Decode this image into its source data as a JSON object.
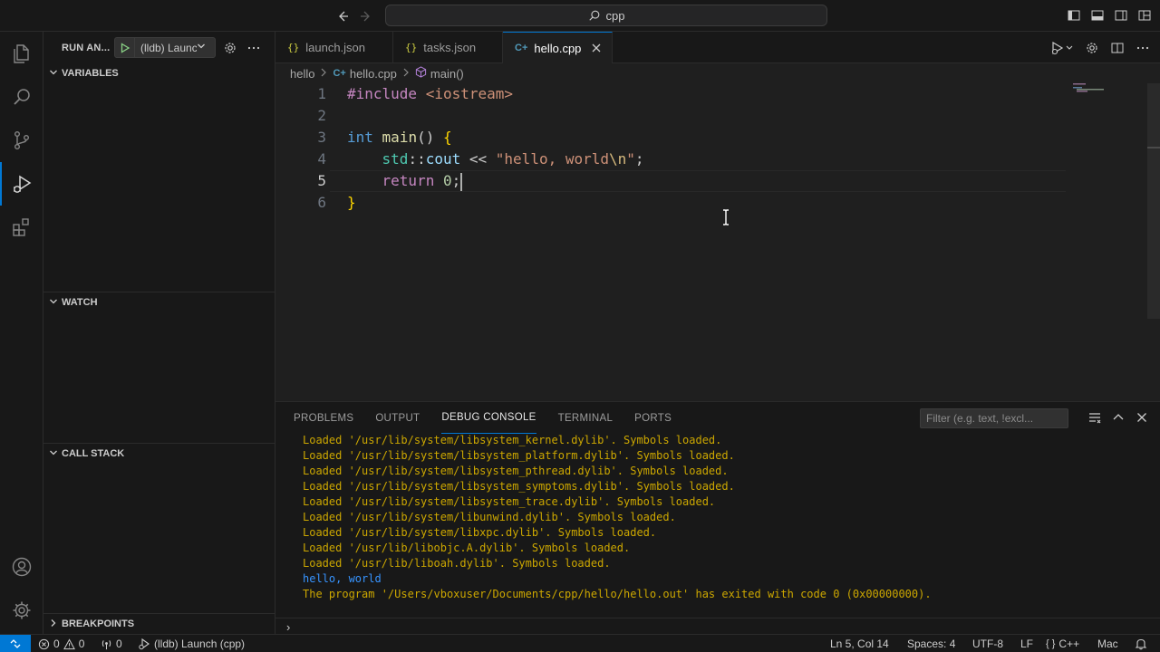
{
  "titlebar": {
    "search_text": "cpp"
  },
  "sidebar": {
    "title": "RUN AN...",
    "launch_config": "(lldb) Launch",
    "sections": {
      "variables": "VARIABLES",
      "watch": "WATCH",
      "call_stack": "CALL STACK",
      "breakpoints": "BREAKPOINTS"
    }
  },
  "tabs": [
    {
      "label": "launch.json",
      "icon": "json-icon"
    },
    {
      "label": "tasks.json",
      "icon": "json-icon"
    },
    {
      "label": "hello.cpp",
      "icon": "cpp-icon",
      "active": true
    }
  ],
  "breadcrumb": {
    "folder": "hello",
    "file": "hello.cpp",
    "symbol": "main()"
  },
  "editor": {
    "line_numbers": [
      "1",
      "2",
      "3",
      "4",
      "5",
      "6"
    ],
    "current_line": 5,
    "code": {
      "l1_directive": "#include",
      "l1_header": "<iostream>",
      "l3_type": "int",
      "l3_fn": "main",
      "l3_parens": "()",
      "l3_brace": "{",
      "l4_ns": "std",
      "l4_scope": "::",
      "l4_var": "cout",
      "l4_op": "<<",
      "l4_str": "\"hello, world",
      "l4_esc": "\\n",
      "l4_strend": "\"",
      "l4_semi": ";",
      "l5_kw": "return",
      "l5_num": "0",
      "l5_semi": ";",
      "l6_brace": "}"
    }
  },
  "panel": {
    "tabs": [
      "PROBLEMS",
      "OUTPUT",
      "DEBUG CONSOLE",
      "TERMINAL",
      "PORTS"
    ],
    "active_tab": "DEBUG CONSOLE",
    "filter_placeholder": "Filter (e.g. text, !excl...",
    "console_lines": [
      "Loaded '/usr/lib/system/libsystem_kernel.dylib'. Symbols loaded.",
      "Loaded '/usr/lib/system/libsystem_platform.dylib'. Symbols loaded.",
      "Loaded '/usr/lib/system/libsystem_pthread.dylib'. Symbols loaded.",
      "Loaded '/usr/lib/system/libsystem_symptoms.dylib'. Symbols loaded.",
      "Loaded '/usr/lib/system/libsystem_trace.dylib'. Symbols loaded.",
      "Loaded '/usr/lib/system/libunwind.dylib'. Symbols loaded.",
      "Loaded '/usr/lib/system/libxpc.dylib'. Symbols loaded.",
      "Loaded '/usr/lib/libobjc.A.dylib'. Symbols loaded.",
      "Loaded '/usr/lib/liboah.dylib'. Symbols loaded.",
      "hello, world",
      "The program '/Users/vboxuser/Documents/cpp/hello/hello.out' has exited with code 0 (0x00000000)."
    ],
    "input_prompt": "›"
  },
  "statusbar": {
    "errors": "0",
    "warnings": "0",
    "ports": "0",
    "debug_config": "(lldb) Launch (cpp)",
    "position": "Ln 5, Col 14",
    "spaces": "Spaces: 4",
    "encoding": "UTF-8",
    "eol": "LF",
    "language": "C++",
    "platform": "Mac"
  },
  "colors": {
    "accent": "#0078d4",
    "console_text": "#cca700",
    "console_output": "#3794ff"
  }
}
